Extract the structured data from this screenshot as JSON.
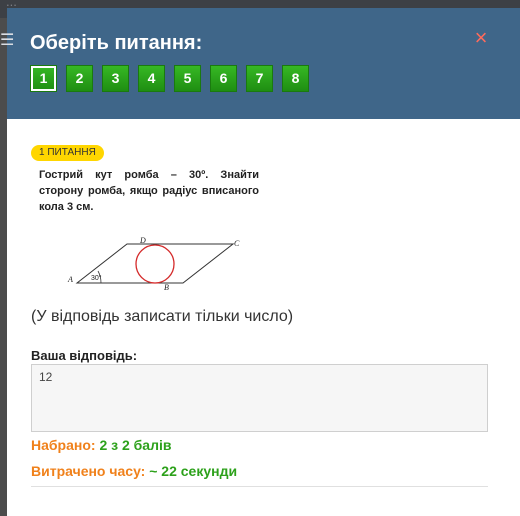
{
  "background": {
    "title_fragment": "... ",
    "menu_icon": "hamburger-menu-icon"
  },
  "modal": {
    "title": "Оберіть питання:",
    "close_glyph": "×",
    "question_numbers": [
      "1",
      "2",
      "3",
      "4",
      "5",
      "6",
      "7",
      "8"
    ],
    "active_question": "1"
  },
  "question": {
    "badge": "1 ПИТАННЯ",
    "text": "Гострий кут ромба – 30º. Знайти сторону ромба, якщо радіус вписаного кола 3 см.",
    "figure": {
      "vertex_a": "A",
      "vertex_b": "B",
      "vertex_c": "C",
      "vertex_d": "D",
      "angle_label": "30°"
    },
    "hint": "(У відповідь записати тільки число)"
  },
  "answer": {
    "label": "Ваша відповідь:",
    "value": "12"
  },
  "result": {
    "score_label": "Набрано:",
    "score_value": "2 з 2 балів",
    "time_label": "Витрачено часу:",
    "time_value": "~ 22 секунди"
  },
  "colors": {
    "header": "#3f6689",
    "question_button": "#2aa41a",
    "close": "#ff6b5b",
    "badge": "#ffd600",
    "label_orange": "#f0811b",
    "value_green": "#2da11b",
    "circle": "#d42a2a"
  }
}
